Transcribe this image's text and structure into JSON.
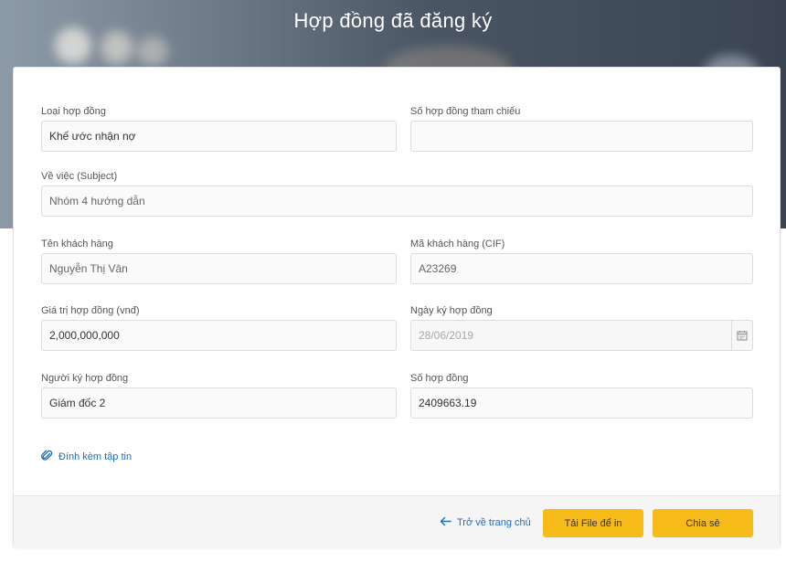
{
  "page": {
    "title": "Hợp đồng đã đăng ký"
  },
  "fields": {
    "contract_type": {
      "label": "Loại hợp đồng",
      "value": "Khế ước nhận nợ"
    },
    "ref_number": {
      "label": "Số hợp đồng tham chiếu",
      "value": ""
    },
    "subject": {
      "label": "Về việc (Subject)",
      "value": "Nhóm 4 hướng dẫn"
    },
    "customer_name": {
      "label": "Tên khách hàng",
      "value": "Nguyễn Thị Vân"
    },
    "customer_cif": {
      "label": "Mã khách hàng (CIF)",
      "value": "A23269"
    },
    "contract_value": {
      "label": "Giá trị hợp đồng (vnđ)",
      "value": "2,000,000,000"
    },
    "sign_date": {
      "label": "Ngày ký hợp đồng",
      "value": "28/06/2019"
    },
    "signer": {
      "label": "Người ký hợp đồng",
      "value": "Giám đốc 2"
    },
    "contract_number": {
      "label": "Số hợp đồng",
      "value": "2409663.19"
    }
  },
  "attach": {
    "label": "Đính kèm tập tin",
    "icon": "paperclip-icon"
  },
  "footer": {
    "back_label": "Trở về trang chủ",
    "download_label": "Tải File để in",
    "share_label": "Chia sẻ"
  },
  "colors": {
    "accent": "#f6bb18",
    "link": "#1e6fb8"
  }
}
